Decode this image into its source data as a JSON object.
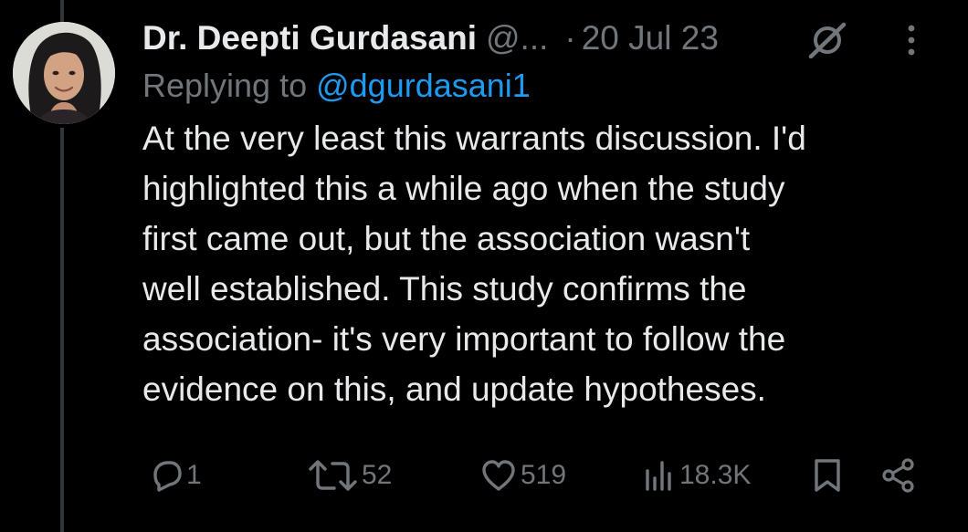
{
  "tweet": {
    "display_name": "Dr. Deepti Gurdasani",
    "handle": "@...",
    "separator": "·",
    "date": "20 Jul 23",
    "replying_prefix": "Replying to ",
    "replying_to": "@dgurdasani1",
    "body_lines": [
      "At the very least this warrants discussion. I'd",
      "highlighted this a while ago when the study",
      "first came out, but the association wasn't",
      "well established. This study confirms the",
      "association- it's very important to follow the",
      "evidence on this, and update hypotheses."
    ]
  },
  "actions": {
    "replies": "1",
    "reposts": "52",
    "likes": "519",
    "views": "18.3K"
  },
  "colors": {
    "background": "#000000",
    "text_primary": "#e7e9ea",
    "text_secondary": "#71767b",
    "link": "#1d9bf0",
    "thread_line": "#333639"
  },
  "icons": [
    "grok-icon",
    "more-icon",
    "reply-icon",
    "repost-icon",
    "like-icon",
    "views-icon",
    "bookmark-icon",
    "share-icon"
  ]
}
